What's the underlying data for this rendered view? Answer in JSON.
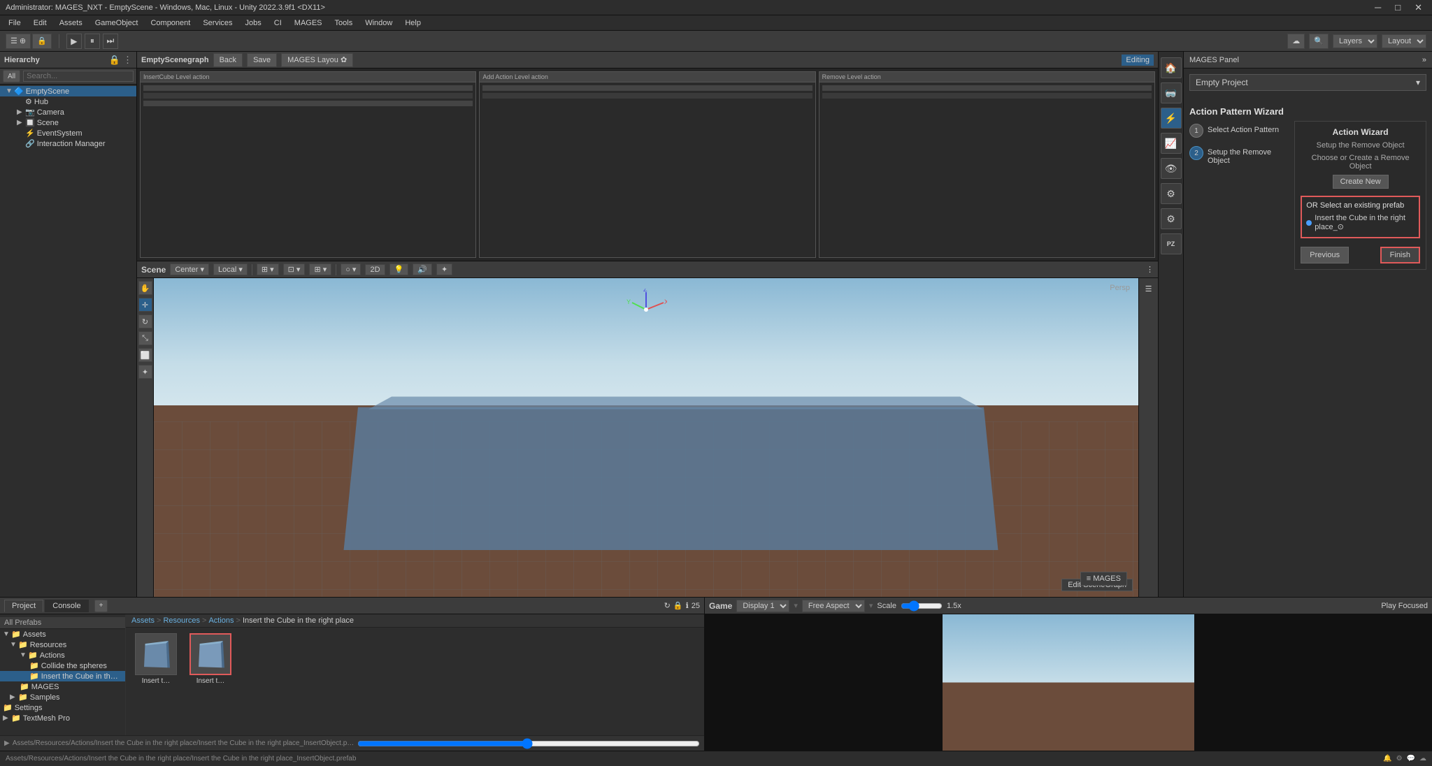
{
  "title_bar": {
    "text": "Administrator: MAGES_NXT - EmptyScene - Windows, Mac, Linux - Unity 2022.3.9f1 <DX11>",
    "min_label": "─",
    "max_label": "□",
    "close_label": "✕"
  },
  "menu_bar": {
    "items": [
      "File",
      "Edit",
      "Assets",
      "GameObject",
      "Component",
      "Services",
      "Jobs",
      "CI",
      "MAGES",
      "Tools",
      "Window",
      "Help"
    ]
  },
  "toolbar": {
    "layers_label": "Layers",
    "layout_label": "Layout"
  },
  "hierarchy": {
    "title": "Hierarchy",
    "all_label": "All",
    "items": [
      {
        "label": "EmptyScene",
        "level": 0,
        "has_arrow": true,
        "expanded": true,
        "icon": "🔷"
      },
      {
        "label": "Hub",
        "level": 1,
        "has_arrow": false,
        "icon": "⚙"
      },
      {
        "label": "Camera",
        "level": 1,
        "has_arrow": true,
        "icon": "📷"
      },
      {
        "label": "Scene",
        "level": 1,
        "has_arrow": true,
        "icon": "🔲"
      },
      {
        "label": "EventSystem",
        "level": 1,
        "has_arrow": false,
        "icon": "⚡"
      },
      {
        "label": "Interaction Manager",
        "level": 1,
        "has_arrow": false,
        "icon": "🔗"
      }
    ]
  },
  "scenegraph": {
    "title": "EmptyScenegraph",
    "back_label": "Back",
    "save_label": "Save",
    "mages_layout_label": "MAGES Layou ✿",
    "editing_label": "Editing"
  },
  "scene": {
    "title": "Scene",
    "persp_label": "Persp",
    "center_label": "Center",
    "local_label": "Local",
    "mages_btn_label": "≡ MAGES",
    "edit_sg_label": "Edit SceneGraph"
  },
  "mages_panel": {
    "title": "MAGES Panel",
    "project_name": "Empty Project",
    "wizard_title": "Action Pattern Wizard",
    "action_wizard_title": "Action Wizard",
    "steps": [
      {
        "number": "1",
        "label": "Select Action Pattern"
      },
      {
        "number": "2",
        "label": "Setup the Remove Object"
      }
    ],
    "right_panel": {
      "title": "Action Wizard",
      "subtitle": "Setup the Remove Object",
      "subtitle2": "Choose or Create a Remove Object",
      "create_btn": "Create New",
      "or_label": "OR Select an existing prefab",
      "prefab_item": "Insert the Cube in the right place_⊙"
    },
    "footer": {
      "previous_label": "Previous",
      "finish_label": "Finish"
    }
  },
  "side_icons": {
    "items": [
      {
        "icon": "🏠",
        "name": "home"
      },
      {
        "icon": "🥽",
        "name": "vr"
      },
      {
        "icon": "⚡",
        "name": "actions"
      },
      {
        "icon": "📈",
        "name": "analytics"
      },
      {
        "icon": "👁",
        "name": "view"
      },
      {
        "icon": "⚙",
        "name": "settings1"
      },
      {
        "icon": "⚙",
        "name": "settings2"
      },
      {
        "icon": "PZ",
        "name": "pz"
      }
    ]
  },
  "project": {
    "tab_project": "Project",
    "tab_console": "Console",
    "add_label": "+",
    "search_label": "All Prefabs",
    "breadcrumb": [
      "Assets",
      ">",
      "Resources",
      ">",
      "Actions",
      ">",
      "Insert the Cube in the right place"
    ],
    "tree_items": [
      {
        "label": "Assets",
        "level": 0,
        "expanded": true,
        "icon": "📁"
      },
      {
        "label": "Resources",
        "level": 1,
        "expanded": true,
        "icon": "📁"
      },
      {
        "label": "Actions",
        "level": 2,
        "expanded": true,
        "icon": "📁"
      },
      {
        "label": "Collide the spheres",
        "level": 3,
        "expanded": false,
        "icon": "📁"
      },
      {
        "label": "Insert the Cube in th…",
        "level": 3,
        "expanded": false,
        "icon": "📁"
      },
      {
        "label": "MAGES",
        "level": 2,
        "expanded": false,
        "icon": "📁"
      },
      {
        "label": "Samples",
        "level": 1,
        "expanded": false,
        "icon": "📁"
      },
      {
        "label": "Settings",
        "level": 0,
        "expanded": false,
        "icon": "📁"
      },
      {
        "label": "TextMesh Pro",
        "level": 0,
        "expanded": false,
        "icon": "📁"
      }
    ],
    "asset1_label": "Insert t…",
    "asset2_label": "Insert t…",
    "status_path": "Assets/Resources/Actions/Insert the Cube in the right place/Insert the Cube in the right place_InsertObject.prefab"
  },
  "game": {
    "title": "Game",
    "display_label": "Display 1",
    "aspect_label": "Free Aspect",
    "scale_label": "Scale",
    "scale_value": "1.5x",
    "play_focused_label": "Play Focused"
  }
}
